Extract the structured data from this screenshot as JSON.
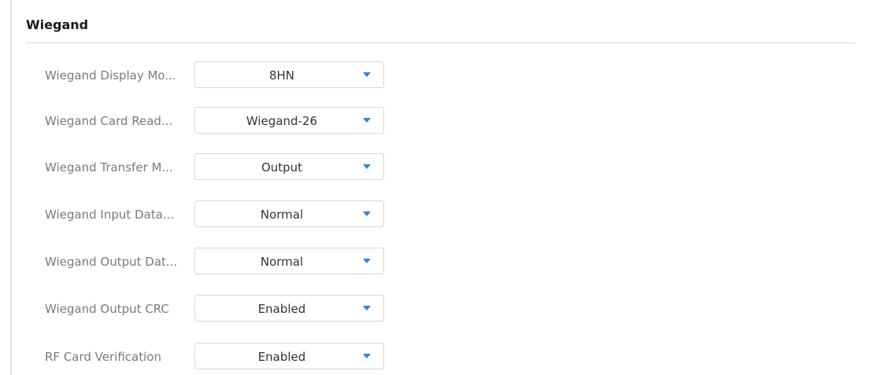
{
  "section": {
    "title": "Wiegand"
  },
  "accent_color": "#1e88e5",
  "settings": [
    {
      "label": "Wiegand Display Mo...",
      "value": "8HN"
    },
    {
      "label": "Wiegand Card Read...",
      "value": "Wiegand-26"
    },
    {
      "label": "Wiegand Transfer M...",
      "value": "Output"
    },
    {
      "label": "Wiegand Input Data...",
      "value": "Normal"
    },
    {
      "label": "Wiegand Output Dat...",
      "value": "Normal"
    },
    {
      "label": "Wiegand Output CRC",
      "value": "Enabled"
    },
    {
      "label": "RF Card Verification",
      "value": "Enabled"
    }
  ]
}
